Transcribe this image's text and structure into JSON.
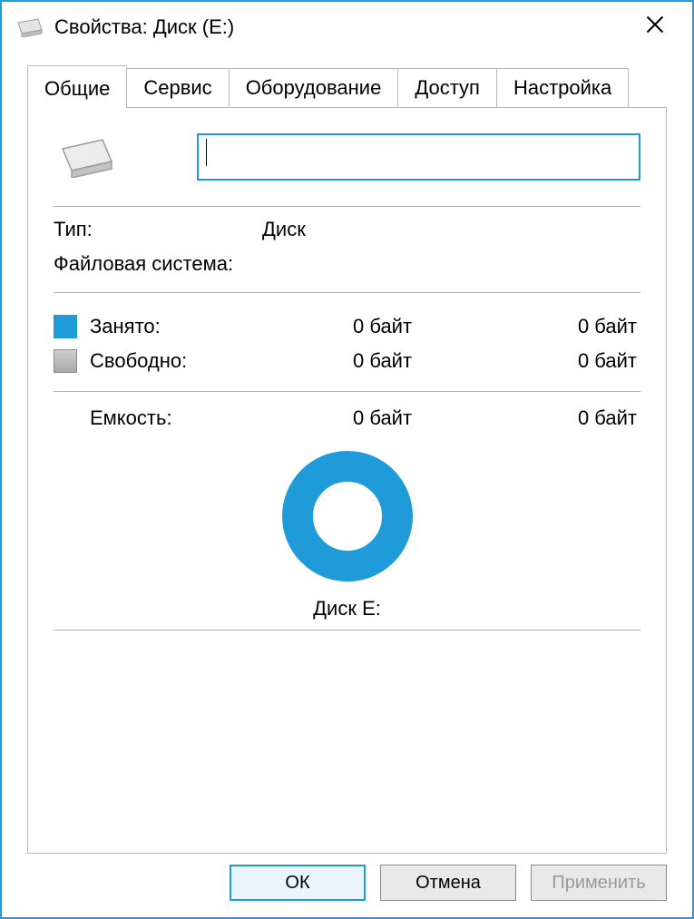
{
  "window": {
    "title": "Свойства: Диск (E:)"
  },
  "tabs": [
    {
      "label": "Общие"
    },
    {
      "label": "Сервис"
    },
    {
      "label": "Оборудование"
    },
    {
      "label": "Доступ"
    },
    {
      "label": "Настройка"
    }
  ],
  "general": {
    "name_value": "",
    "type_label": "Тип:",
    "type_value": "Диск",
    "fs_label": "Файловая система:",
    "fs_value": "",
    "used_label": "Занято:",
    "used_bytes": "0 байт",
    "used_human": "0 байт",
    "free_label": "Свободно:",
    "free_bytes": "0 байт",
    "free_human": "0 байт",
    "capacity_label": "Емкость:",
    "capacity_bytes": "0 байт",
    "capacity_human": "0 байт",
    "donut_label": "Диск E:"
  },
  "chart_data": {
    "type": "pie",
    "title": "Диск E:",
    "series": [
      {
        "name": "Занято",
        "value": 0,
        "color": "#1e9bd8"
      },
      {
        "name": "Свободно",
        "value": 0,
        "color": "#b0b0b0"
      }
    ]
  },
  "buttons": {
    "ok": "ОК",
    "cancel": "Отмена",
    "apply": "Применить"
  },
  "colors": {
    "accent": "#1e9bd8",
    "swatch_free": "#b0b0b0"
  }
}
